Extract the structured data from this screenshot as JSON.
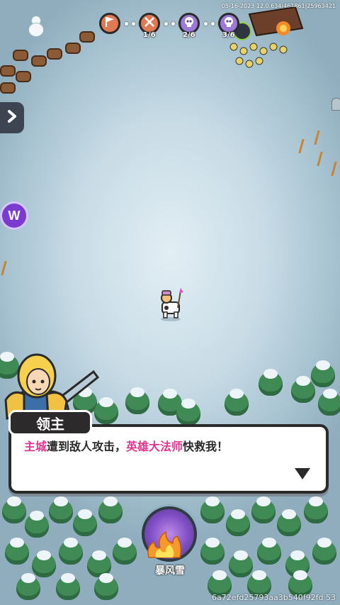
{
  "status": {
    "build_info": "05-16-2023 12.0.634|461861|25963421"
  },
  "wave": {
    "nodes": [
      {
        "icon": "flag-icon",
        "color": "#e07a55"
      },
      {
        "icon": "sword-icon",
        "color": "#e07a55",
        "count": "1/6"
      },
      {
        "icon": "skull-icon",
        "color": "#9d79d8",
        "count": "2/6"
      },
      {
        "icon": "skull-icon",
        "color": "#9d79d8",
        "count": "3/6"
      }
    ],
    "separator": "•••"
  },
  "dialog": {
    "speaker": "领主",
    "line_part1": "主城",
    "line_part2": "遭到敌人攻击，",
    "line_part3": "英雄大法师",
    "line_part4": "快救我！",
    "highlight_color": "#e0368f",
    "next_icon": "triangle-down-icon"
  },
  "skill": {
    "label": "暴风雪",
    "icon": "blizzard-fire-icon"
  },
  "side": {
    "expand_icon": "chevron-right-icon",
    "menu_icon_letter": "W"
  },
  "footer": {
    "hash": "6a72efd25793aa3b540f92fd 53"
  }
}
